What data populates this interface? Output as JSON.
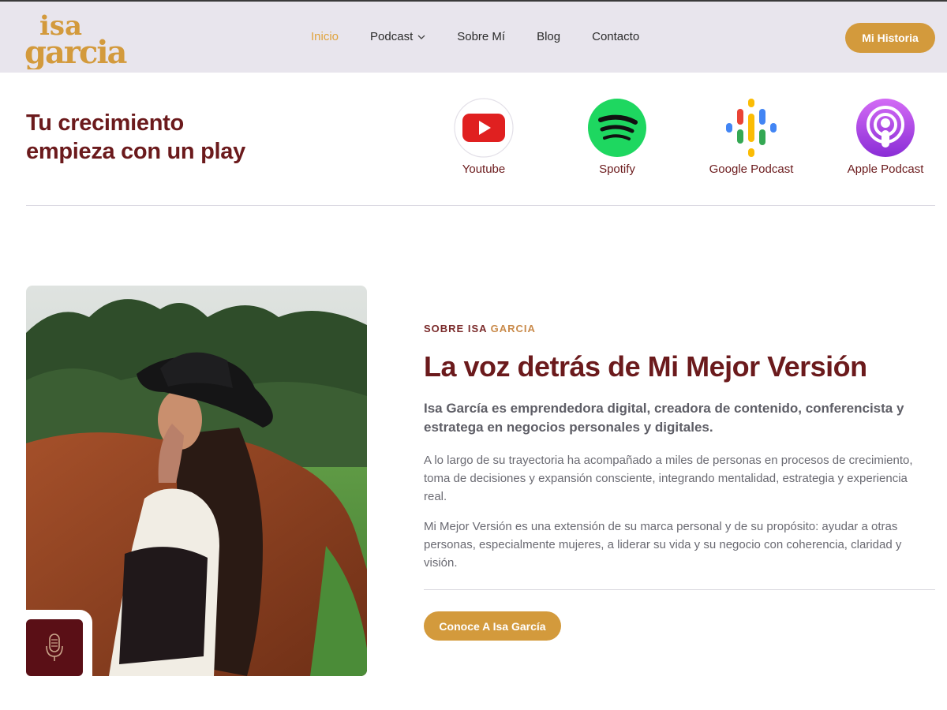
{
  "header": {
    "logo_text": "isa garcia",
    "nav": [
      {
        "label": "Inicio",
        "active": true
      },
      {
        "label": "Podcast",
        "has_dropdown": true
      },
      {
        "label": "Sobre Mí"
      },
      {
        "label": "Blog"
      },
      {
        "label": "Contacto"
      }
    ],
    "cta_label": "Mi Historia"
  },
  "podcast": {
    "tagline_line1": "Tu crecimiento",
    "tagline_line2": "empieza con un play",
    "platforms": [
      {
        "label": "Youtube",
        "icon": "youtube-icon"
      },
      {
        "label": "Spotify",
        "icon": "spotify-icon"
      },
      {
        "label": "Google Podcast",
        "icon": "google-podcast-icon"
      },
      {
        "label": "Apple Podcast",
        "icon": "apple-podcast-icon"
      }
    ]
  },
  "about": {
    "eyebrow_main": "SOBRE ISA",
    "eyebrow_accent": "GARCIA",
    "headline": "La voz detrás de Mi Mejor Versión",
    "lead": "Isa García es emprendedora digital, creadora de contenido, conferencista y estratega en negocios personales y digitales.",
    "paragraph1": "A lo largo de su trayectoria ha acompañado a miles de personas en procesos de crecimiento, toma de decisiones y expansión consciente, integrando mentalidad, estrategia y experiencia real.",
    "paragraph2": "Mi Mejor Versión es una extensión de su marca personal y de su propósito: ayudar a otras personas, especialmente mujeres, a liderar su vida y su negocio con coherencia, claridad y visión.",
    "cta_label": "Conoce A Isa García",
    "badge_icon": "microphone-icon"
  },
  "colors": {
    "header_bg": "#e8e5ed",
    "brand_gold": "#d39a3c",
    "brand_maroon": "#6b1a1c",
    "nav_active": "#e0a33c",
    "badge_bg": "#5a0f16"
  }
}
